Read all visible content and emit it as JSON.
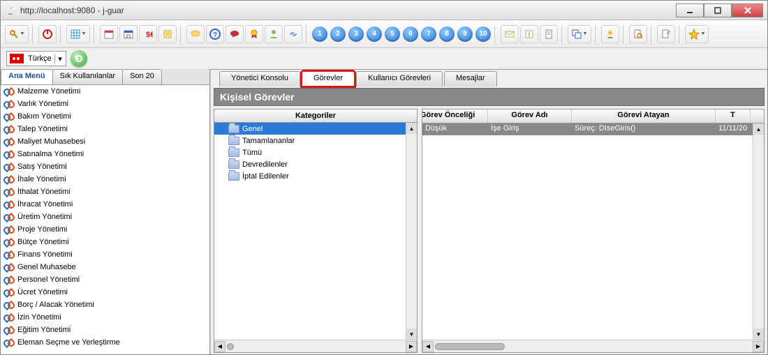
{
  "window": {
    "title": "http://localhost:9080 - j-guar"
  },
  "lang": {
    "label": "Türkçe"
  },
  "side_tabs": [
    {
      "label": "Ana Menü",
      "active": true
    },
    {
      "label": "Sık Kullanılanlar",
      "active": false
    },
    {
      "label": "Son 20",
      "active": false
    }
  ],
  "sidebar_items": [
    "Malzeme Yönetimi",
    "Varlık Yönetimi",
    "Bakım Yönetimi",
    "Talep Yönetimi",
    "Maliyet Muhasebesi",
    "Satınalma Yönetimi",
    "Satış Yönetimi",
    "İhale Yönetimi",
    "İthalat Yönetimi",
    "İhracat Yönetimi",
    "Üretim Yönetimi",
    "Proje Yönetimi",
    "Bütçe Yönetimi",
    "Finans Yönetimi",
    "Genel Muhasebe",
    "Personel Yönetimi",
    "Ücret Yönetimi",
    "Borç / Alacak Yönetimi",
    "İzin Yönetimi",
    "Eğitim Yönetimi",
    "Eleman Seçme ve Yerleştirme"
  ],
  "main_tabs": [
    {
      "label": "Yönetici Konsolu",
      "active": false,
      "highlight": false
    },
    {
      "label": "Görevler",
      "active": true,
      "highlight": true
    },
    {
      "label": "Kullanıcı Görevleri",
      "active": false,
      "highlight": false
    },
    {
      "label": "Mesajlar",
      "active": false,
      "highlight": false
    }
  ],
  "section_title": "Kişisel Görevler",
  "categories_header": "Kategoriler",
  "categories": [
    {
      "label": "Genel",
      "selected": true
    },
    {
      "label": "Tamamlananlar",
      "selected": false
    },
    {
      "label": "Tümü",
      "selected": false
    },
    {
      "label": "Devredilenler",
      "selected": false
    },
    {
      "label": "İptal Edilenler",
      "selected": false
    }
  ],
  "task_columns": [
    "Görev Önceliği",
    "Görev Adı",
    "Görevi Atayan",
    "T"
  ],
  "task_rows": [
    {
      "priority": "Düşük",
      "name": "İşe Giriş",
      "assigner": "Süreç: DIseGiris()",
      "date": "11/11/20"
    }
  ],
  "number_buttons": [
    "1",
    "2",
    "3",
    "4",
    "5",
    "6",
    "7",
    "8",
    "9",
    "10"
  ],
  "col_widths": {
    "c0": 94,
    "c1": 120,
    "c2": 206,
    "c3": 50
  }
}
